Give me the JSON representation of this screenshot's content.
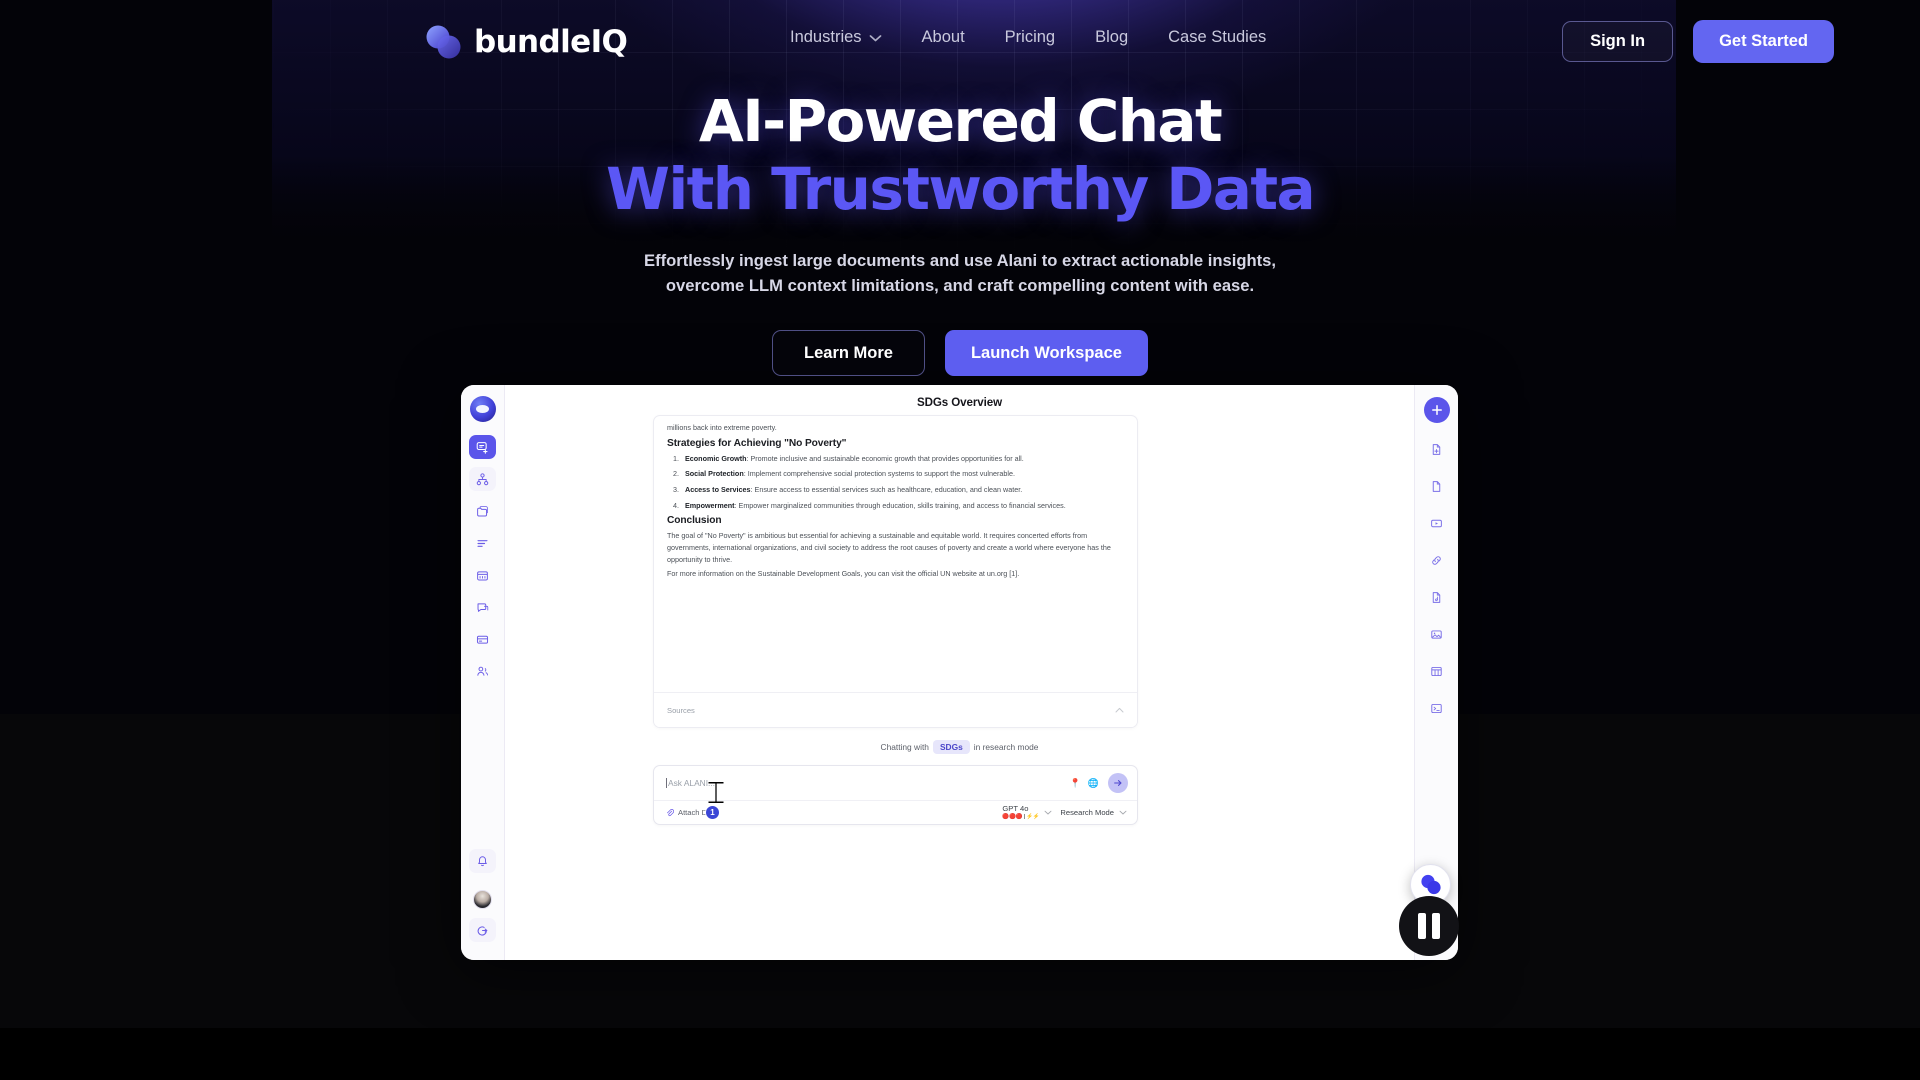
{
  "brand": {
    "name": "bundleIQ",
    "logo_icon": "bundleiq-logo-icon"
  },
  "nav": {
    "links": [
      {
        "label": "Industries",
        "has_dropdown": true,
        "icon": "chevron-down-icon"
      },
      {
        "label": "About",
        "has_dropdown": false
      },
      {
        "label": "Pricing",
        "has_dropdown": false
      },
      {
        "label": "Blog",
        "has_dropdown": false
      },
      {
        "label": "Case Studies",
        "has_dropdown": false
      }
    ],
    "sign_in": "Sign In",
    "get_started": "Get Started"
  },
  "hero": {
    "title_line1": "AI-Powered Chat",
    "title_line2": "With Trustworthy Data",
    "subtitle_line1": "Effortlessly ingest large documents and use Alani to extract actionable insights,",
    "subtitle_line2": "overcome LLM context limitations, and craft compelling content with ease.",
    "cta_secondary": "Learn More",
    "cta_primary": "Launch Workspace"
  },
  "app": {
    "title": "SDGs Overview",
    "left_rail": [
      {
        "icon": "app-logo-icon",
        "name": "workspace-logo"
      },
      {
        "icon": "new-chat-icon",
        "name": "new-chat",
        "active": true
      },
      {
        "icon": "knowledge-graph-icon",
        "name": "knowledge-graph"
      },
      {
        "icon": "folder-icon",
        "name": "files"
      },
      {
        "icon": "list-lines-icon",
        "name": "notes"
      },
      {
        "icon": "calendar-icon",
        "name": "calendar"
      },
      {
        "icon": "chat-bubble-icon",
        "name": "conversations"
      },
      {
        "icon": "card-icon",
        "name": "billing"
      },
      {
        "icon": "people-icon",
        "name": "team"
      }
    ],
    "left_rail_bottom": [
      {
        "icon": "bell-icon",
        "name": "notifications"
      },
      {
        "icon": "avatar",
        "name": "user-avatar"
      },
      {
        "icon": "logout-icon",
        "name": "logout"
      }
    ],
    "right_rail": [
      {
        "icon": "plus-icon",
        "name": "add-source",
        "primary": true
      },
      {
        "icon": "file-add-icon",
        "name": "add-file"
      },
      {
        "icon": "document-icon",
        "name": "document"
      },
      {
        "icon": "video-icon",
        "name": "video"
      },
      {
        "icon": "link-icon",
        "name": "link"
      },
      {
        "icon": "audio-file-icon",
        "name": "audio"
      },
      {
        "icon": "image-icon",
        "name": "image"
      },
      {
        "icon": "table-icon",
        "name": "table"
      },
      {
        "icon": "terminal-icon",
        "name": "terminal"
      }
    ],
    "document": {
      "intro": "millions back into extreme poverty.",
      "heading_strategies": "Strategies for Achieving \"No Poverty\"",
      "strategies": [
        {
          "num": "1.",
          "term": "Economic Growth",
          "text": ": Promote inclusive and sustainable economic growth that provides opportunities for all."
        },
        {
          "num": "2.",
          "term": "Social Protection",
          "text": ": Implement comprehensive social protection systems to support the most vulnerable."
        },
        {
          "num": "3.",
          "term": "Access to Services",
          "text": ": Ensure access to essential services such as healthcare, education, and clean water."
        },
        {
          "num": "4.",
          "term": "Empowerment",
          "text": ": Empower marginalized communities through education, skills training, and access to financial services."
        }
      ],
      "heading_conclusion": "Conclusion",
      "conclusion_p1": "The goal of \"No Poverty\" is ambitious but essential for achieving a sustainable and equitable world. It requires concerted efforts from governments, international organizations, and civil society to address the root causes of poverty and create a world where everyone has the opportunity to thrive.",
      "conclusion_p2": "For more information on the Sustainable Development Goals, you can visit the official UN website at un.org [1].",
      "sources_label": "Sources",
      "sources_toggle_icon": "chevron-up-icon"
    },
    "chat": {
      "meta_prefix": "Chatting with",
      "meta_pill": "SDGs",
      "meta_suffix": "in research mode",
      "input_placeholder": "Ask ALANI...",
      "input_value": "",
      "attach_label": "Attach Data",
      "attach_icon": "paperclip-icon",
      "model_name": "GPT 4o",
      "model_dots": "🔴🔴🔴 | ⚡⚡",
      "mode_label": "Research Mode",
      "send_icon": "arrow-right-icon",
      "chip_icons": [
        "location-pin-icon",
        "globe-icon"
      ],
      "cursor_badge_count": "1"
    }
  },
  "player": {
    "fab_icon": "bundleiq-logo-icon",
    "pause_icon": "pause-icon"
  },
  "colors": {
    "accent": "#5b55ea",
    "accent_light": "#6366f1",
    "heading_accent": "#5b57f5",
    "hero_bg": "#07061a",
    "page_bg": "#030308"
  }
}
